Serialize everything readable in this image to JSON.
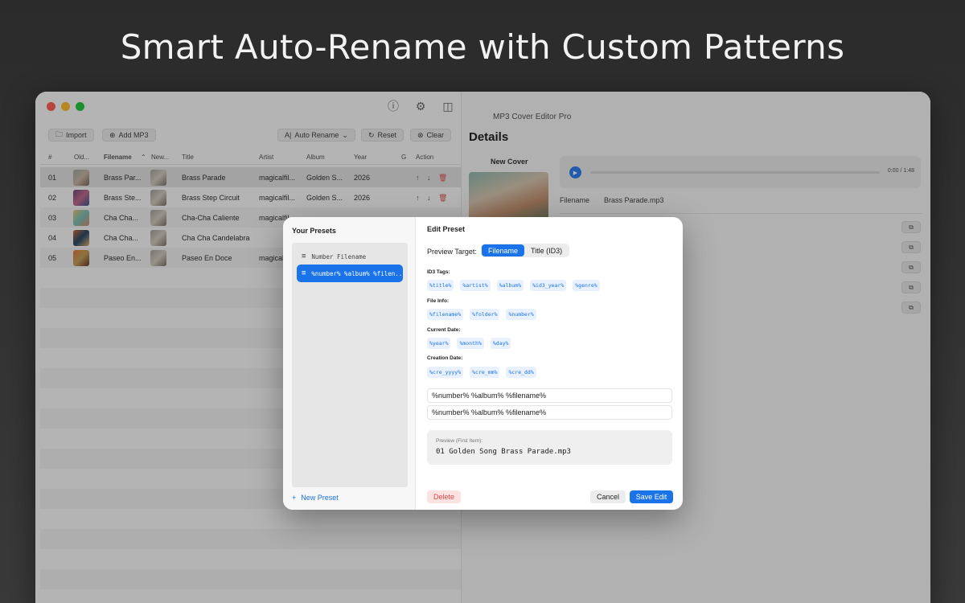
{
  "headline": "Smart Auto-Rename with Custom Patterns",
  "app_title": "MP3 Cover Editor Pro",
  "toolbar": {
    "import_label": "Import",
    "add_mp3_label": "Add MP3",
    "auto_rename_label": "Auto Rename",
    "reset_label": "Reset",
    "clear_label": "Clear"
  },
  "table": {
    "headers": {
      "num": "#",
      "old": "Old...",
      "filename": "Filename",
      "new": "New...",
      "title": "Title",
      "artist": "Artist",
      "album": "Album",
      "year": "Year",
      "genre": "G",
      "action": "Action"
    },
    "rows": [
      {
        "num": "01",
        "filename": "Brass Par...",
        "title": "Brass Parade",
        "artist": "magicalfil...",
        "album": "Golden S...",
        "year": "2026"
      },
      {
        "num": "02",
        "filename": "Brass Ste...",
        "title": "Brass Step Circuit",
        "artist": "magicalfil...",
        "album": "Golden S...",
        "year": "2026"
      },
      {
        "num": "03",
        "filename": "Cha Cha...",
        "title": "Cha-Cha Caliente",
        "artist": "magicalfil...",
        "album": "",
        "year": ""
      },
      {
        "num": "04",
        "filename": "Cha Cha...",
        "title": "Cha Cha Candelabra",
        "artist": "",
        "album": "",
        "year": ""
      },
      {
        "num": "05",
        "filename": "Paseo En...",
        "title": "Paseo En Doce",
        "artist": "magical",
        "album": "",
        "year": ""
      }
    ]
  },
  "details": {
    "title": "Details",
    "new_cover_label": "New Cover",
    "time": "0:00 / 1:48",
    "progress": 0,
    "filename_label": "Filename",
    "filename_value": "Brass Parade.mp3"
  },
  "modal": {
    "presets_title": "Your Presets",
    "presets": [
      {
        "label": "Number Filename",
        "active": false
      },
      {
        "label": "%number% %album% %filen...",
        "active": true
      }
    ],
    "new_preset_label": "New Preset",
    "edit_title": "Edit Preset",
    "preview_target_label": "Preview Target:",
    "target_options": [
      "Filename",
      "Title (ID3)"
    ],
    "selected_target": "Filename",
    "groups": [
      {
        "label": "ID3 Tags:",
        "tags": [
          "%title%",
          "%artist%",
          "%album%",
          "%id3_year%",
          "%genre%"
        ]
      },
      {
        "label": "File Info:",
        "tags": [
          "%filename%",
          "%folder%",
          "%number%"
        ]
      },
      {
        "label": "Current Date:",
        "tags": [
          "%year%",
          "%month%",
          "%day%"
        ]
      },
      {
        "label": "Creation Date:",
        "tags": [
          "%cre_yyyy%",
          "%cre_mm%",
          "%cre_dd%"
        ]
      }
    ],
    "name_input": "%number% %album% %filename%",
    "pattern_input": "%number% %album% %filename%",
    "preview_label": "Preview (First Item):",
    "preview_value": "01 Golden Song Brass Parade.mp3",
    "delete_label": "Delete",
    "cancel_label": "Cancel",
    "save_label": "Save Edit"
  },
  "colors": {
    "accent": "#1a73e8",
    "danger": "#e04848"
  }
}
